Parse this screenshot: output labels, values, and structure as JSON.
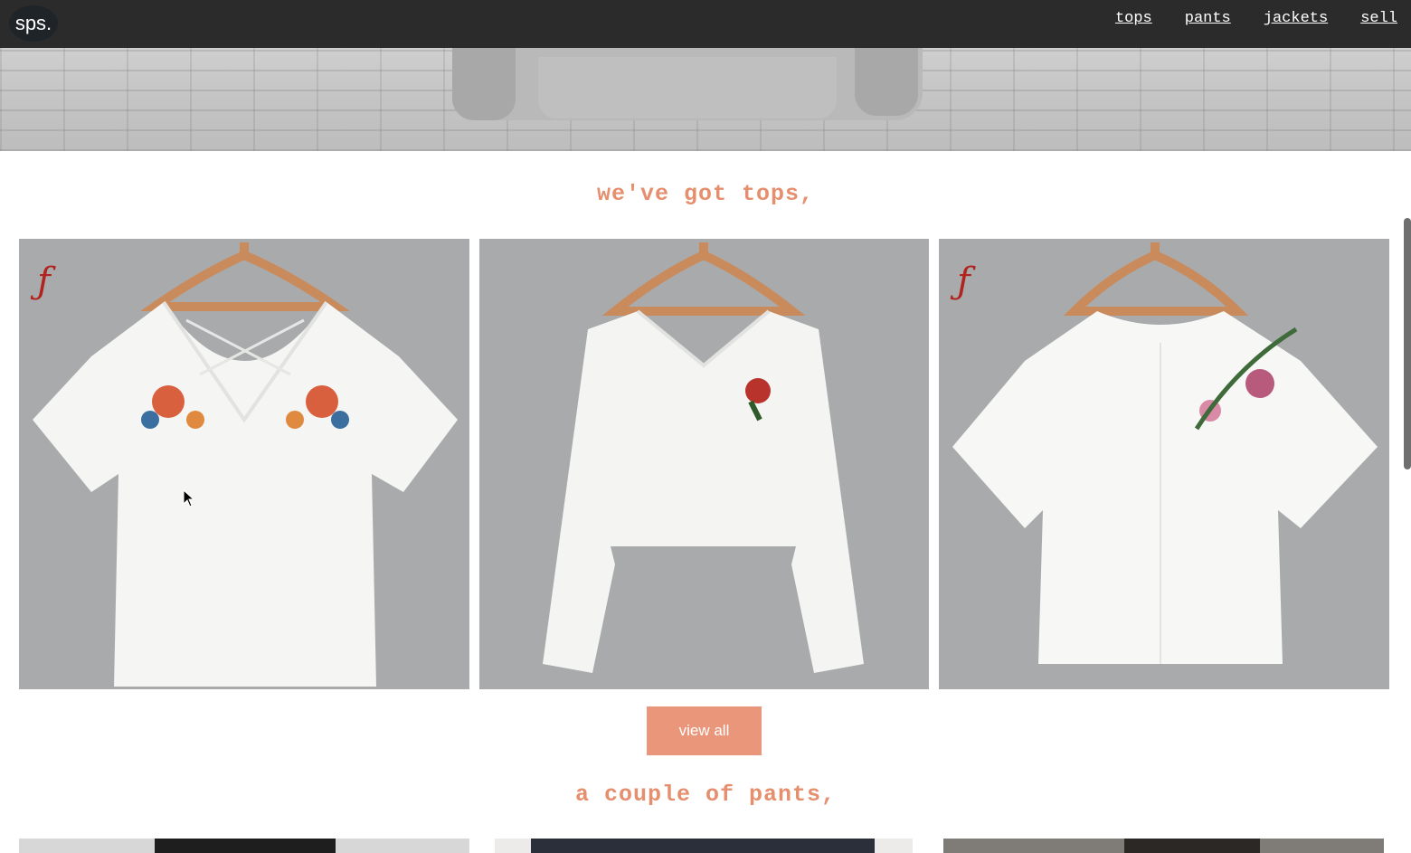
{
  "header": {
    "logo": "sps.",
    "nav": [
      {
        "label": "tops"
      },
      {
        "label": "pants"
      },
      {
        "label": "jackets"
      },
      {
        "label": "sell"
      }
    ]
  },
  "sections": {
    "tops": {
      "title": "we've got tops,",
      "products": [
        {
          "name": "embroidered v-neck tee",
          "badge": "f"
        },
        {
          "name": "rose patch cold shoulder top",
          "badge": ""
        },
        {
          "name": "floral embroidered tee",
          "badge": "f"
        }
      ],
      "button_label": "view all"
    },
    "pants": {
      "title": "a couple of pants,"
    }
  },
  "colors": {
    "accent": "#e9967a",
    "heading": "#e58f6f",
    "navbar": "#2b2b2b"
  }
}
